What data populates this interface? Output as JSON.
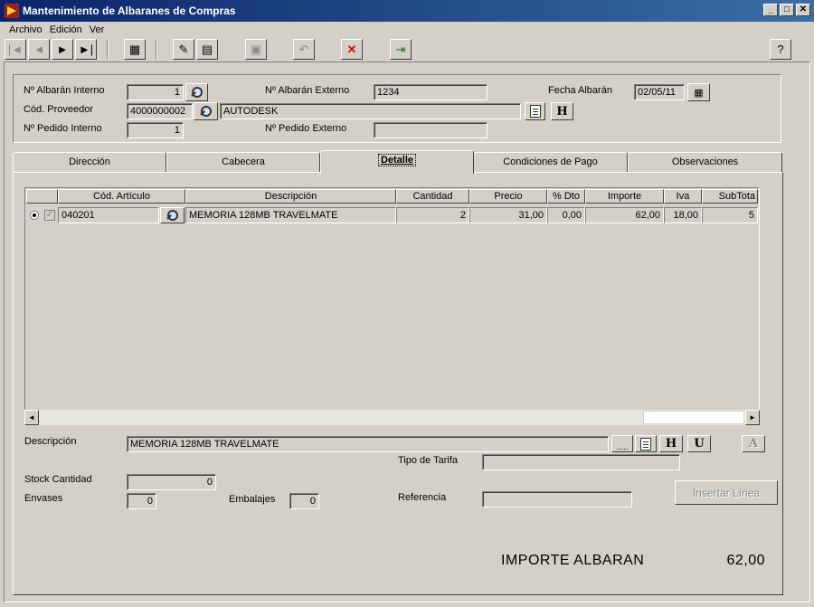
{
  "window": {
    "title": "Mantenimiento de Albaranes de Compras",
    "controls": [
      "_",
      "□",
      "✕"
    ]
  },
  "menu": [
    {
      "label": "Archivo"
    },
    {
      "label": "Edición"
    },
    {
      "label": "Ver"
    }
  ],
  "toolbar": {
    "icons": [
      "first-record-icon",
      "previous-record-icon",
      "next-record-icon",
      "last-record-icon",
      "grid-view-icon",
      "new-record-icon",
      "edit-record-icon",
      "save-icon",
      "undo-icon",
      "delete-icon",
      "exit-icon",
      "help-icon"
    ]
  },
  "header": {
    "albaran_interno_label": "Nº Albarán Interno",
    "albaran_interno_value": "1",
    "albaran_externo_label": "Nº Albarán Externo",
    "albaran_externo_value": "1234",
    "fecha_label": "Fecha Albarán",
    "fecha_value": "02/05/11",
    "proveedor_label": "Cód. Proveedor",
    "proveedor_code": "4000000002",
    "proveedor_name": "AUTODESK",
    "pedido_interno_label": "Nº Pedido Interno",
    "pedido_interno_value": "1",
    "pedido_externo_label": "Nº Pedido Externo",
    "pedido_externo_value": "",
    "h_button": "H"
  },
  "tabs": [
    {
      "label": "Dirección"
    },
    {
      "label": "Cabecera"
    },
    {
      "label": "Detalle"
    },
    {
      "label": "Condiciones de Pago"
    },
    {
      "label": "Observaciones"
    }
  ],
  "grid": {
    "columns": [
      "Cód. Artículo",
      "Descripción",
      "Cantidad",
      "Precio",
      "% Dto",
      "Importe",
      "Iva",
      "SubTota"
    ],
    "rows": [
      {
        "codigo": "040201",
        "descripcion": "MEMORIA 128MB TRAVELMATE",
        "cantidad": "2",
        "precio": "31,00",
        "dto": "0,00",
        "importe": "62,00",
        "iva": "18,00",
        "subtotal": "5"
      }
    ],
    "scroll_left": "◄",
    "scroll_right": "►"
  },
  "detail": {
    "descripcion_label": "Descripción",
    "descripcion_value": "MEMORIA 128MB TRAVELMATE",
    "dots_button": ".....",
    "h_button": "H",
    "u_button": "U",
    "a_button": "A",
    "tipo_tarifa_label": "Tipo de Tarifa",
    "tipo_tarifa_value": "",
    "stock_label": "Stock Cantidad",
    "stock_value": "0",
    "envases_label": "Envases",
    "envases_value": "0",
    "embalajes_label": "Embalajes",
    "embalajes_value": "0",
    "referencia_label": "Referencia",
    "referencia_value": "",
    "insertar_button": "Insertar Línea"
  },
  "totals": {
    "importe_label": "IMPORTE ALBARAN",
    "importe_value": "62,00"
  }
}
